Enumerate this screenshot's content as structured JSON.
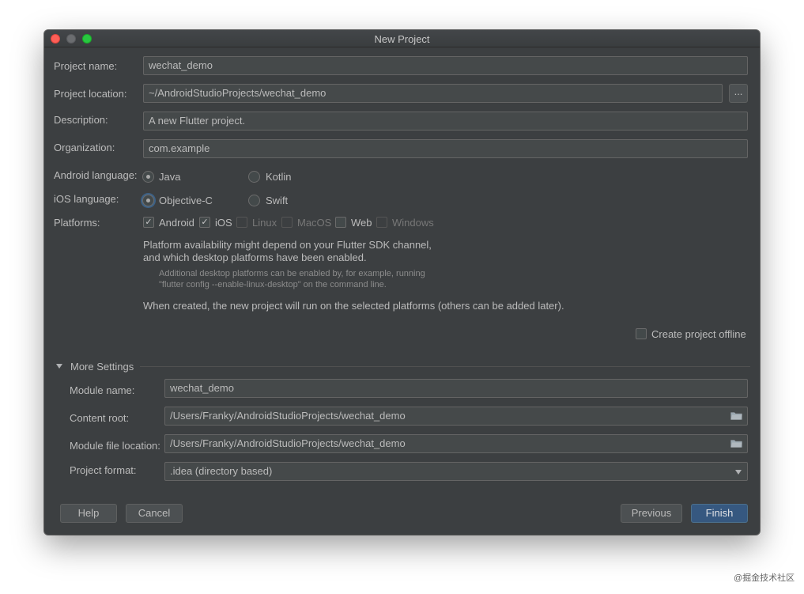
{
  "window": {
    "title": "New Project"
  },
  "form": {
    "project_name": {
      "label": "Project name:",
      "value": "wechat_demo"
    },
    "project_location": {
      "label": "Project location:",
      "value": "~/AndroidStudioProjects/wechat_demo",
      "browse_label": "..."
    },
    "description": {
      "label": "Description:",
      "value": "A new Flutter project."
    },
    "organization": {
      "label": "Organization:",
      "value": "com.example"
    },
    "android_language": {
      "label": "Android language:",
      "options": [
        "Java",
        "Kotlin"
      ],
      "selected": "Java"
    },
    "ios_language": {
      "label": "iOS language:",
      "options": [
        "Objective-C",
        "Swift"
      ],
      "selected": "Objective-C"
    },
    "platforms": {
      "label": "Platforms:",
      "items": [
        {
          "label": "Android",
          "checked": true,
          "enabled": true
        },
        {
          "label": "iOS",
          "checked": true,
          "enabled": true
        },
        {
          "label": "Linux",
          "checked": false,
          "enabled": false
        },
        {
          "label": "MacOS",
          "checked": false,
          "enabled": false
        },
        {
          "label": "Web",
          "checked": false,
          "enabled": true
        },
        {
          "label": "Windows",
          "checked": false,
          "enabled": false
        }
      ]
    },
    "info_line1": "Platform availability might depend on your Flutter SDK channel,",
    "info_line2": "and which desktop platforms have been enabled.",
    "hint_line1": "Additional desktop platforms can be enabled by, for example, running",
    "hint_line2": "\"flutter config --enable-linux-desktop\" on the command line.",
    "created_note": "When created, the new project will run on the selected platforms (others can be added later).",
    "create_offline": {
      "label": "Create project offline",
      "checked": false
    }
  },
  "more_settings": {
    "title": "More Settings",
    "module_name": {
      "label": "Module name:",
      "value": "wechat_demo"
    },
    "content_root": {
      "label": "Content root:",
      "value": "/Users/Franky/AndroidStudioProjects/wechat_demo"
    },
    "module_file_location": {
      "label": "Module file location:",
      "value": "/Users/Franky/AndroidStudioProjects/wechat_demo"
    },
    "project_format": {
      "label": "Project format:",
      "value": ".idea (directory based)"
    }
  },
  "buttons": {
    "help": "Help",
    "cancel": "Cancel",
    "previous": "Previous",
    "finish": "Finish"
  },
  "watermark": "@掘金技术社区",
  "colors": {
    "background": "#3c3f41",
    "field": "#45494a",
    "primary_button": "#365880",
    "text": "#bbbbbb"
  },
  "icons": [
    "folder-icon",
    "chevron-down-icon",
    "check-icon",
    "radio-dot-icon"
  ]
}
